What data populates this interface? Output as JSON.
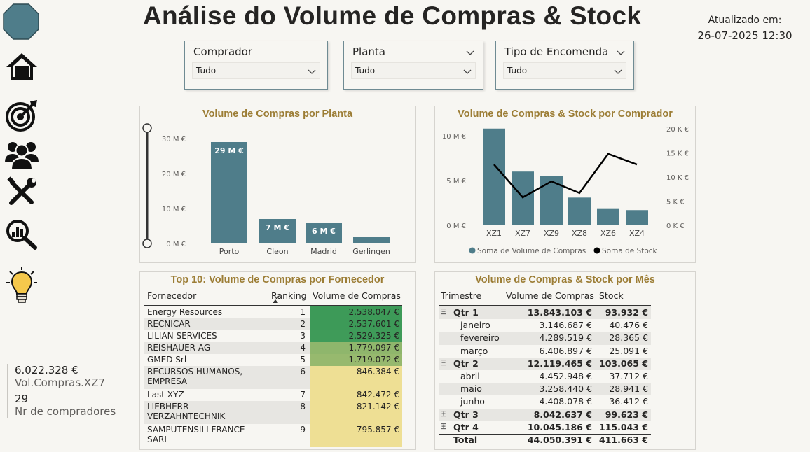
{
  "header": {
    "title": "Análise do Volume de Compras & Stock",
    "updated_label": "Atualizado em:",
    "updated_value": "26-07-2025 12:30"
  },
  "nav": {
    "icons": [
      "logo-icon",
      "home-icon",
      "target-icon",
      "users-icon",
      "tools-icon",
      "analytics-icon",
      "lightbulb-icon"
    ]
  },
  "kpis": [
    {
      "value": "6.022.328 €",
      "label": "Vol.Compras.XZ7"
    },
    {
      "value": "29",
      "label": "Nr de compradores"
    }
  ],
  "slicers": [
    {
      "title": "Comprador",
      "value": "Tudo"
    },
    {
      "title": "Planta",
      "value": "Tudo"
    },
    {
      "title": "Tipo de Encomenda",
      "value": "Tudo"
    }
  ],
  "chart_planta": {
    "title": "Volume de Compras por Planta",
    "yticks": [
      "30 M €",
      "20 M €",
      "10 M €",
      "0 M €"
    ]
  },
  "chart_comprador": {
    "title": "Volume de Compras & Stock por Comprador",
    "yticks_left": [
      "10 M €",
      "5 M €",
      "0 M €"
    ],
    "yticks_right": [
      "20 K €",
      "15 K €",
      "10 K €",
      "5 K €",
      "0 K €"
    ],
    "legend": [
      "Soma de Volume de Compras",
      "Soma de Stock"
    ]
  },
  "chart_data": [
    {
      "type": "bar",
      "title": "Volume de Compras por Planta",
      "categories": [
        "Porto",
        "Cleon",
        "Madrid",
        "Gerlingen"
      ],
      "values": [
        29,
        7,
        6,
        1.8
      ],
      "data_labels": [
        "29 M €",
        "7 M €",
        "6 M €",
        ""
      ],
      "ylim": [
        0,
        30
      ],
      "color": "#4f7d8a"
    },
    {
      "type": "bar",
      "title": "Volume de Compras & Stock por Comprador",
      "categories": [
        "XZ1",
        "XZ7",
        "XZ9",
        "XZ8",
        "XZ6",
        "XZ4"
      ],
      "series": [
        {
          "name": "Soma de Volume de Compras",
          "values": [
            10.8,
            6.0,
            5.5,
            3.1,
            1.9,
            1.7
          ],
          "axis": "left",
          "color": "#4f7d8a"
        },
        {
          "name": "Soma de Stock",
          "type": "line",
          "values": [
            12.6,
            5.8,
            9.1,
            6.7,
            14.8,
            12.6
          ],
          "axis": "right",
          "color": "#000000"
        }
      ],
      "ylim_left": [
        0,
        10
      ],
      "ylim_right": [
        0,
        20
      ],
      "legend_position": "bottom"
    }
  ],
  "top10": {
    "title": "Top 10: Volume de Compras por Fornecedor",
    "columns": [
      "Fornecedor",
      "Ranking",
      "Volume de Compras"
    ],
    "rows": [
      {
        "name": "Energy Resources",
        "rank": "1",
        "value": "2.538.047 €",
        "color": "#3d9a58"
      },
      {
        "name": "RECNICAR",
        "rank": "2",
        "value": "2.537.601 €",
        "color": "#3d9a58"
      },
      {
        "name": "LILIAN SERVICES",
        "rank": "3",
        "value": "2.529.325 €",
        "color": "#3f9b59"
      },
      {
        "name": "REISHAUER AG",
        "rank": "4",
        "value": "1.779.097 €",
        "color": "#8fb66c"
      },
      {
        "name": "GMED Srl",
        "rank": "5",
        "value": "1.719.072 €",
        "color": "#97b96e"
      },
      {
        "name": "RECURSOS HUMANOS, EMPRESA",
        "rank": "6",
        "value": "846.384 €",
        "color": "#eedf94"
      },
      {
        "name": "Last XYZ",
        "rank": "7",
        "value": "842.472 €",
        "color": "#eedf94"
      },
      {
        "name": "LIEBHERR VERZAHNTECHNIK",
        "rank": "8",
        "value": "821.142 €",
        "color": "#eedf94"
      },
      {
        "name": "SAMPUTENSILI FRANCE SARL",
        "rank": "9",
        "value": "795.857 €",
        "color": "#eedf94"
      }
    ]
  },
  "monthly": {
    "title": "Volume de Compras & Stock por Mês",
    "columns": [
      "Trimestre",
      "Volume de Compras",
      "Stock"
    ],
    "rows": [
      {
        "label": "Qtr 1",
        "compras": "13.843.103 €",
        "stock": "93.932 €",
        "level": 0,
        "toggle": "⊟"
      },
      {
        "label": "janeiro",
        "compras": "3.146.687 €",
        "stock": "40.476 €",
        "level": 1
      },
      {
        "label": "fevereiro",
        "compras": "4.289.519 €",
        "stock": "28.365 €",
        "level": 1
      },
      {
        "label": "março",
        "compras": "6.406.897 €",
        "stock": "25.091 €",
        "level": 1
      },
      {
        "label": "Qtr 2",
        "compras": "12.119.465 €",
        "stock": "103.065 €",
        "level": 0,
        "toggle": "⊟"
      },
      {
        "label": "abril",
        "compras": "4.452.948 €",
        "stock": "37.712 €",
        "level": 1
      },
      {
        "label": "maio",
        "compras": "3.258.440 €",
        "stock": "28.941 €",
        "level": 1
      },
      {
        "label": "junho",
        "compras": "4.408.078 €",
        "stock": "36.412 €",
        "level": 1
      },
      {
        "label": "Qtr 3",
        "compras": "8.042.637 €",
        "stock": "99.623 €",
        "level": 0,
        "toggle": "⊞"
      },
      {
        "label": "Qtr 4",
        "compras": "10.045.186 €",
        "stock": "115.043 €",
        "level": 0,
        "toggle": "⊞"
      },
      {
        "label": "Total",
        "compras": "44.050.391 €",
        "stock": "411.663 €",
        "level": 0,
        "total": true
      }
    ]
  }
}
